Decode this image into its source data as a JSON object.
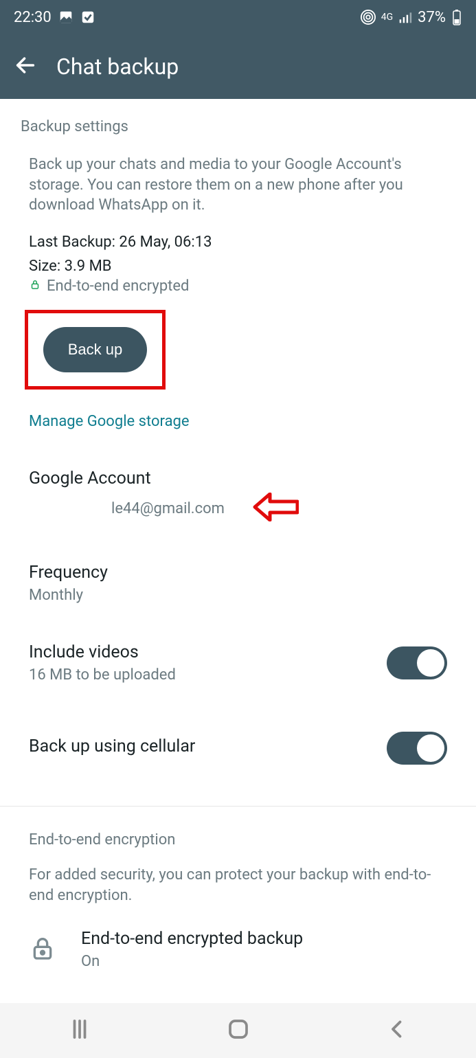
{
  "status": {
    "time": "22:30",
    "network": "4G",
    "battery": "37%"
  },
  "header": {
    "title": "Chat backup"
  },
  "backup": {
    "section": "Backup settings",
    "description": "Back up your chats and media to your Google Account's storage. You can restore them on a new phone after you download WhatsApp on it.",
    "lastBackupLabel": "Last Backup: 26 May, 06:13",
    "sizeLabel": "Size: 3.9 MB",
    "encryptedLabel": "End-to-end encrypted",
    "backupButton": "Back up",
    "manageStorage": "Manage Google storage"
  },
  "googleAccount": {
    "title": "Google Account",
    "email": "le44@gmail.com"
  },
  "frequency": {
    "title": "Frequency",
    "value": "Monthly"
  },
  "includeVideos": {
    "title": "Include videos",
    "sub": "16 MB to be uploaded"
  },
  "cellular": {
    "title": "Back up using cellular"
  },
  "encryption": {
    "section": "End-to-end encryption",
    "description": "For added security, you can protect your backup with end-to-end encryption.",
    "rowTitle": "End-to-end encrypted backup",
    "rowSub": "On"
  }
}
